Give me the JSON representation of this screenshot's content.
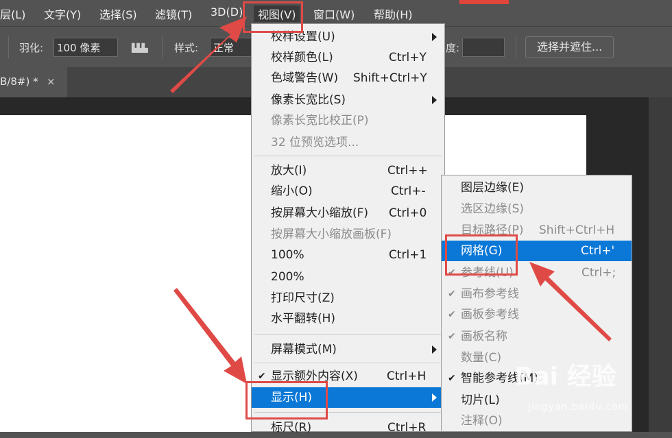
{
  "menubar": {
    "items": [
      "层(L)",
      "文字(Y)",
      "选择(S)",
      "滤镜(T)",
      "3D(D)",
      "视图(V)",
      "窗口(W)",
      "帮助(H)"
    ],
    "active": "视图(V)"
  },
  "options_bar": {
    "feather_label": "羽化:",
    "feather_value": "100 像素",
    "style_label": "样式:",
    "style_value": "正常",
    "height_label": "度:",
    "select_mask_button": "选择并遮住..."
  },
  "document_tab": {
    "title": "B/8#) *",
    "close": "×"
  },
  "view_menu": {
    "items": [
      {
        "label": "校样设置(U)",
        "shortcut": "",
        "submenu": true,
        "disabled": false
      },
      {
        "label": "校样颜色(L)",
        "shortcut": "Ctrl+Y",
        "disabled": false
      },
      {
        "label": "色域警告(W)",
        "shortcut": "Shift+Ctrl+Y",
        "disabled": false
      },
      {
        "label": "像素长宽比(S)",
        "shortcut": "",
        "submenu": true,
        "disabled": false
      },
      {
        "label": "像素长宽比校正(P)",
        "shortcut": "",
        "disabled": true
      },
      {
        "label": "32 位预览选项...",
        "shortcut": "",
        "disabled": true
      },
      {
        "label": "放大(I)",
        "shortcut": "Ctrl++",
        "disabled": false
      },
      {
        "label": "缩小(O)",
        "shortcut": "Ctrl+-",
        "disabled": false
      },
      {
        "label": "按屏幕大小缩放(F)",
        "shortcut": "Ctrl+0",
        "disabled": false
      },
      {
        "label": "按屏幕大小缩放画板(F)",
        "shortcut": "",
        "disabled": true
      },
      {
        "label": "100%",
        "shortcut": "Ctrl+1",
        "disabled": false
      },
      {
        "label": "200%",
        "shortcut": "",
        "disabled": false
      },
      {
        "label": "打印尺寸(Z)",
        "shortcut": "",
        "disabled": false
      },
      {
        "label": "水平翻转(H)",
        "shortcut": "",
        "disabled": false
      },
      {
        "label": "屏幕模式(M)",
        "shortcut": "",
        "submenu": true,
        "disabled": false
      },
      {
        "label": "显示额外内容(X)",
        "shortcut": "Ctrl+H",
        "checked": true,
        "disabled": false
      },
      {
        "label": "显示(H)",
        "shortcut": "",
        "submenu": true,
        "highlighted": true,
        "disabled": false
      },
      {
        "label": "标尺(R)",
        "shortcut": "Ctrl+R",
        "disabled": false
      }
    ]
  },
  "show_submenu": {
    "items": [
      {
        "label": "图层边缘(E)",
        "shortcut": "",
        "disabled": false
      },
      {
        "label": "选区边缘(S)",
        "shortcut": "",
        "disabled": true
      },
      {
        "label": "目标路径(P)",
        "shortcut": "Shift+Ctrl+H",
        "disabled": true
      },
      {
        "label": "网格(G)",
        "shortcut": "Ctrl+'",
        "highlighted": true,
        "disabled": false
      },
      {
        "label": "参考线(U)",
        "shortcut": "Ctrl+;",
        "checked": true,
        "disabled": true
      },
      {
        "label": "画布参考线",
        "shortcut": "",
        "checked": true,
        "disabled": true
      },
      {
        "label": "画板参考线",
        "shortcut": "",
        "checked": true,
        "disabled": true
      },
      {
        "label": "画板名称",
        "shortcut": "",
        "checked": true,
        "disabled": true
      },
      {
        "label": "数量(C)",
        "shortcut": "",
        "disabled": true
      },
      {
        "label": "智能参考线(M)",
        "shortcut": "",
        "checked": true,
        "disabled": false
      },
      {
        "label": "切片(L)",
        "shortcut": "",
        "disabled": false
      },
      {
        "label": "注释(O)",
        "shortcut": "",
        "disabled": true
      }
    ]
  },
  "watermark": {
    "main": "Bai 经验",
    "url": "jingyan.baidu.com"
  },
  "colors": {
    "highlight": "#0b78d7",
    "annotation_red": "#e04a46",
    "menu_bg": "#f0f0f0",
    "app_bg": "#535353"
  }
}
